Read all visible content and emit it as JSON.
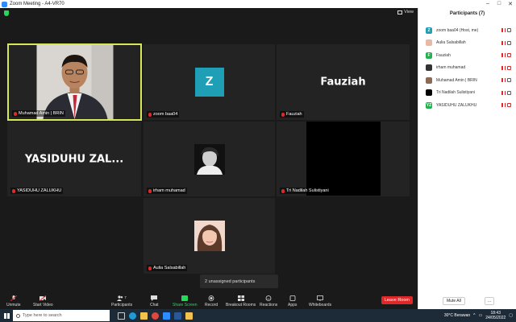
{
  "window": {
    "title": "Zoom Meeting - A4-VR70"
  },
  "meeting": {
    "view_label": "View",
    "tiles": [
      {
        "name": "Muhamad Amin | BRIN",
        "type": "video"
      },
      {
        "name": "zoom baa04",
        "type": "avatar",
        "initial": "Z"
      },
      {
        "name": "Fauziah",
        "type": "text",
        "display": "Fauziah"
      },
      {
        "name": "YASIDUHU ZALUKHU",
        "type": "text",
        "display": "YASIDUHU  ZAL..."
      },
      {
        "name": "irham muhamad",
        "type": "photo"
      },
      {
        "name": "Tri Nadilah Sulistiyani",
        "type": "black"
      },
      {
        "name": "Aulia Salsabillah",
        "type": "photo"
      }
    ],
    "unassigned": "2 unassigned participants"
  },
  "toolbar": {
    "unmute": "Unmute",
    "start_video": "Start Video",
    "participants": "Participants",
    "participants_count": "7",
    "chat": "Chat",
    "share_screen": "Share Screen",
    "record": "Record",
    "breakout": "Breakout Rooms",
    "reactions": "Reactions",
    "apps": "Apps",
    "whiteboards": "Whiteboards",
    "leave": "Leave Room"
  },
  "panel": {
    "title": "Participants (7)",
    "participants": [
      {
        "name": "zoom baa04 (Host, me)",
        "initial": "Z",
        "color": "#1e9fb5"
      },
      {
        "name": "Aulia Salsabillah",
        "initial": "",
        "color": "#e8b9a6"
      },
      {
        "name": "Fauziah",
        "initial": "F",
        "color": "#23b14d"
      },
      {
        "name": "irham muhamad",
        "initial": "",
        "color": "#333333"
      },
      {
        "name": "Muhamad Amin | BRIN",
        "initial": "",
        "color": "#8a6b55"
      },
      {
        "name": "Tri Nadilah Sulistiyani",
        "initial": "",
        "color": "#000000"
      },
      {
        "name": "YASIDUHU ZALUKHU",
        "initial": "YZ",
        "color": "#23b14d"
      }
    ],
    "mute_all": "Mute All",
    "more": "..."
  },
  "taskbar": {
    "search_placeholder": "Type here to search",
    "weather": "30°C  Berawan",
    "time": "18:43",
    "date": "24/05/2022"
  },
  "colors": {
    "accent": "#2d8cff",
    "active_speaker": "#d6e85a",
    "mute_red": "#e02828",
    "share_green": "#23d959"
  }
}
